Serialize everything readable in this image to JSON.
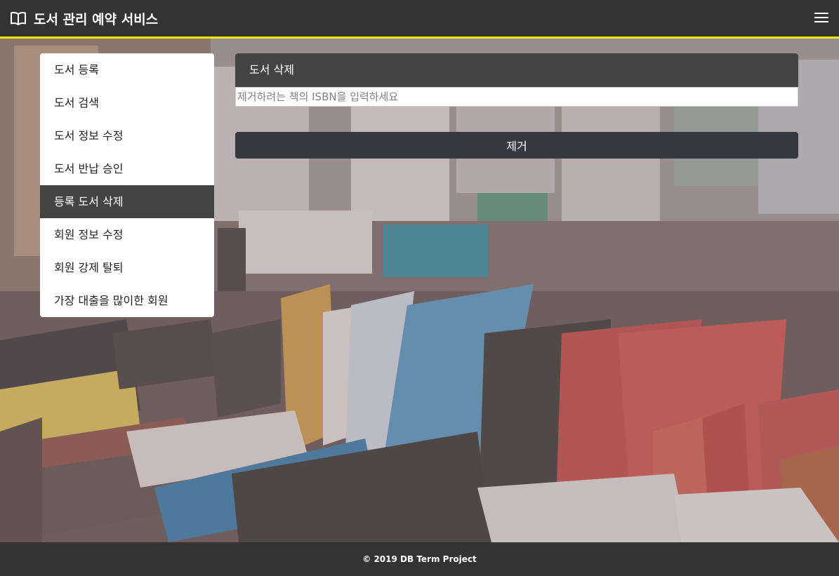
{
  "header": {
    "title": "도서 관리 예약 서비스",
    "brand_icon": "open-book-icon",
    "menu_icon": "hamburger-menu-icon",
    "accent_color": "#f2e600",
    "background_color": "#333333"
  },
  "sidebar": {
    "items": [
      {
        "label": "도서 등록",
        "active": false
      },
      {
        "label": "도서 검색",
        "active": false
      },
      {
        "label": "도서 정보 수정",
        "active": false
      },
      {
        "label": "도서 반납 승인",
        "active": false
      },
      {
        "label": "등록 도서 삭제",
        "active": true
      },
      {
        "label": "회원 정보 수정",
        "active": false
      },
      {
        "label": "회원 강제 탈퇴",
        "active": false
      },
      {
        "label": "가장 대출을 많이한 회원",
        "active": false
      }
    ]
  },
  "main": {
    "panel_title": "도서 삭제",
    "isbn_input": {
      "value": "",
      "placeholder": "제거하려는 책의 ISBN을 입력하세요"
    },
    "remove_label": "제거"
  },
  "footer": {
    "text": "© 2019 DB Term Project"
  }
}
